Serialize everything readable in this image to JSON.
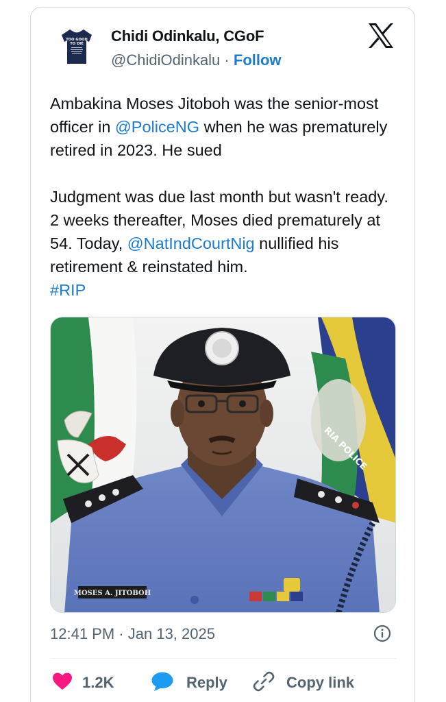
{
  "author": {
    "name": "Chidi Odinkalu, CGoF",
    "handle": "@ChidiOdinkalu",
    "separator": "·",
    "follow_label": "Follow",
    "avatar_shirt_text_top": "TOO GOOD",
    "avatar_shirt_text_mid": "TO DIE"
  },
  "tweet": {
    "p1_a": "Ambakina Moses Jitoboh was the senior-most officer in ",
    "p1_mention": "@PoliceNG",
    "p1_b": " when he was prematurely retired in 2023. He sued",
    "p2_a": "Judgment was due last month but wasn't ready. 2 weeks thereafter, Moses died prematurely at 54. Today, ",
    "p2_mention": "@NatIndCourtNig",
    "p2_b": " nullified his retirement & reinstated him.",
    "hashtag": "#RIP"
  },
  "media": {
    "name_tag": "MOSES A. JITOBOH",
    "flag_text": "RIA POLICE"
  },
  "meta": {
    "time": "12:41 PM",
    "separator": "·",
    "date": "Jan 13, 2025"
  },
  "actions": {
    "like_count": "1.2K",
    "reply_label": "Reply",
    "copy_label": "Copy link"
  },
  "colors": {
    "link": "#1d7bd0",
    "heart": "#f91880",
    "reply_bubble": "#1d9bf0",
    "muted": "#536471"
  },
  "icons": [
    "x-logo-icon",
    "info-icon",
    "heart-icon",
    "reply-bubble-icon",
    "link-chain-icon"
  ]
}
